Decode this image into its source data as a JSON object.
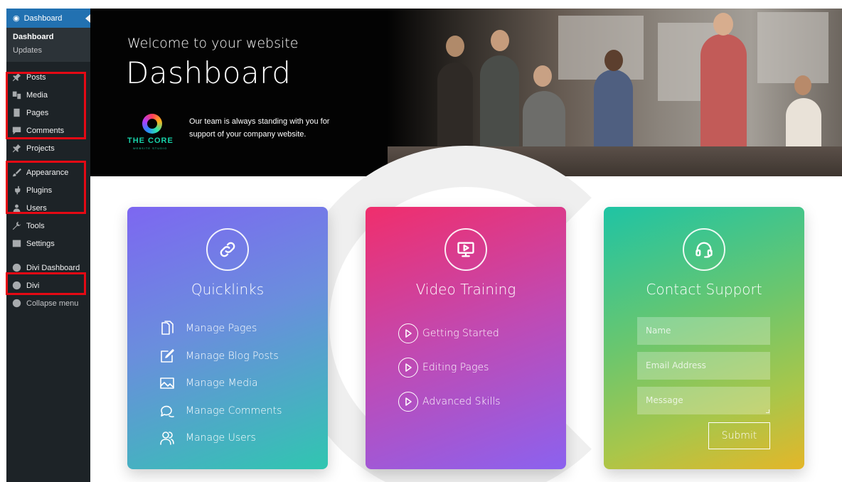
{
  "sidebar": {
    "header_label": "Dashboard",
    "submenu": [
      "Dashboard",
      "Updates"
    ],
    "items": [
      {
        "label": "Posts",
        "icon": "pin-icon"
      },
      {
        "label": "Media",
        "icon": "media-icon"
      },
      {
        "label": "Pages",
        "icon": "pages-icon"
      },
      {
        "label": "Comments",
        "icon": "comment-icon"
      },
      {
        "label": "Projects",
        "icon": "pin-icon"
      },
      {
        "label": "Appearance",
        "icon": "brush-icon"
      },
      {
        "label": "Plugins",
        "icon": "plug-icon"
      },
      {
        "label": "Users",
        "icon": "user-icon"
      },
      {
        "label": "Tools",
        "icon": "wrench-icon"
      },
      {
        "label": "Settings",
        "icon": "settings-icon"
      },
      {
        "label": "Divi Dashboard",
        "icon": "gauge-icon"
      },
      {
        "label": "Divi",
        "icon": "divi-icon"
      }
    ],
    "collapse_label": "Collapse menu"
  },
  "hero": {
    "subtitle": "Welcome to your website",
    "title": "Dashboard",
    "logo_text": "THE CORE",
    "logo_small": "WEBSITE STUDIO",
    "note": "Our team is always standing with you for support of your company website."
  },
  "cards": {
    "quicklinks": {
      "title": "Quicklinks",
      "items": [
        "Manage Pages",
        "Manage Blog Posts",
        "Manage Media",
        "Manage Comments",
        "Manage Users"
      ]
    },
    "video": {
      "title": "Video Training",
      "items": [
        "Getting Started",
        "Editing Pages",
        "Advanced Skills"
      ]
    },
    "support": {
      "title": "Contact Support",
      "name_placeholder": "Name",
      "email_placeholder": "Email Address",
      "message_placeholder": "Message",
      "submit_label": "Submit"
    }
  },
  "colors": {
    "sidebar_bg": "#1d2327",
    "sidebar_active": "#2271b1",
    "highlight": "#e50914",
    "logo_accent": "#17d1a8"
  }
}
